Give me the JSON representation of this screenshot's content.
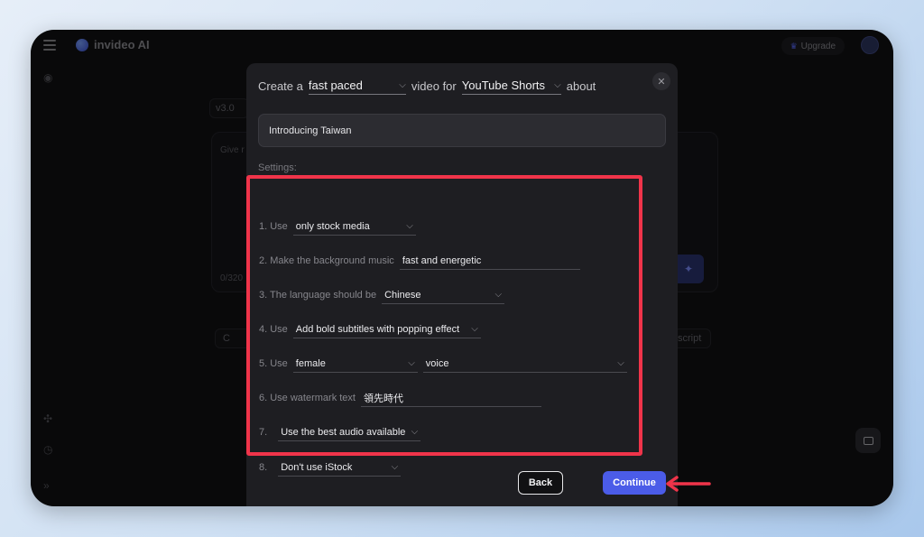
{
  "app": {
    "name": "invideo AI"
  },
  "header": {
    "upgrade_label": "Upgrade"
  },
  "background": {
    "version": "v3.0",
    "card_placeholder": "Give r",
    "char_count": "0/320",
    "chip_left": "C",
    "chip_right": "script"
  },
  "modal": {
    "prefix": "Create a",
    "pace_value": "fast paced",
    "middle": "video for",
    "platform_value": "YouTube Shorts",
    "suffix": "about",
    "topic_value": "Introducing Taiwan",
    "settings_label": "Settings:",
    "close_icon": "close-icon"
  },
  "settings": [
    {
      "label": "1. Use",
      "value": "only stock media",
      "type": "select"
    },
    {
      "label": "2. Make the background music",
      "value": "fast and energetic",
      "type": "text"
    },
    {
      "label": "3. The language should be",
      "value": "Chinese",
      "type": "select"
    },
    {
      "label": "4. Use",
      "value": "Add bold subtitles with popping effect",
      "type": "select"
    },
    {
      "label": "5. Use",
      "value": "female",
      "value2": "voice",
      "type": "select2"
    },
    {
      "label": "6. Use watermark text",
      "value": "領先時代",
      "type": "text"
    },
    {
      "label": "7.",
      "value": "Use the best audio available",
      "type": "select"
    },
    {
      "label": "8.",
      "value": "Don't use iStock",
      "type": "select"
    }
  ],
  "footer": {
    "back_label": "Back",
    "continue_label": "Continue"
  },
  "colors": {
    "accent": "#4b5ce8",
    "highlight": "#f0344a",
    "modal_bg": "#1e1e22",
    "frame_bg": "#111113"
  }
}
